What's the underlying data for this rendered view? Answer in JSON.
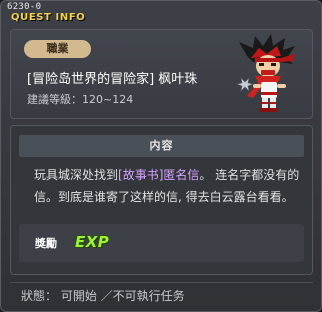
{
  "window": {
    "quest_id": "6230-0",
    "title": "QUEST INFO"
  },
  "header": {
    "job_label": "職業",
    "quest_name": "[冒险岛世界的冒险家] 枫叶珠",
    "level_text": "建議等級：120~124",
    "npc": "npc-sprite"
  },
  "content": {
    "section_title": "内容",
    "description": {
      "part1": "玩具城深处找到",
      "highlight": "[故事书]匿名信",
      "part2": "。 连名字都没有的信。到底是谁寄了这样的信, 得去白云露台看看。"
    },
    "reward_label": "獎勵",
    "reward_icon_text": "EXP"
  },
  "footer": {
    "status_text": "狀態： 可開始 ／不可執行任务"
  },
  "colors": {
    "title": "#f3d34a",
    "highlight": "#d6a3ff",
    "exp": "#9cf23a"
  }
}
